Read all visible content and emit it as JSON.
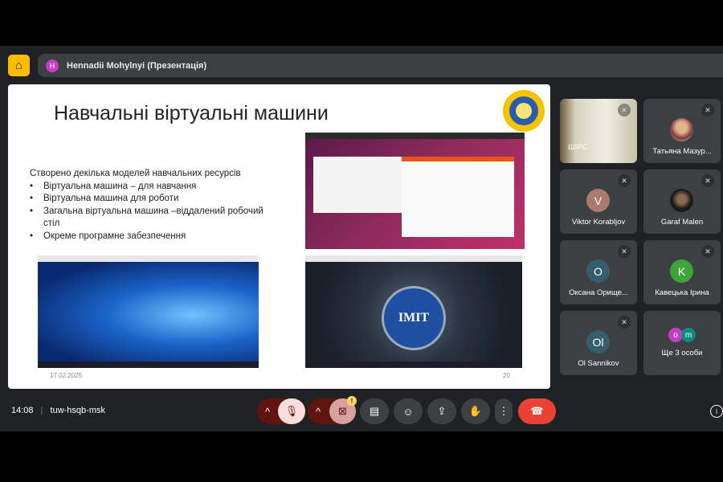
{
  "header": {
    "presenter_initial": "H",
    "presenter_label": "Hennadii Mohylnyi (Презентація)"
  },
  "slide": {
    "title": "Навчальні віртуальні машини",
    "intro": "Створено декілька моделей навчальних ресурсів",
    "bullets": [
      "Віртуальна машина – для навчання",
      "Віртуальна машина для роботи",
      "Загальна віртуальна машина –віддалений робочий стіл",
      "Окреме програмне забезпечення"
    ],
    "date": "17.02.2025",
    "page": "20",
    "imit_label": "IMIT"
  },
  "participants": [
    {
      "name": "ШІРС",
      "type": "video"
    },
    {
      "name": "Татьяна Мазур...",
      "type": "photo"
    },
    {
      "name": "Viktor Korabljov",
      "initial": "V",
      "color": "#a97a6e"
    },
    {
      "name": "Garaf Malen",
      "type": "photo"
    },
    {
      "name": "Оксана Орище...",
      "initial": "О",
      "color": "#355d6b"
    },
    {
      "name": "Кавецька Ірина",
      "initial": "K",
      "color": "#3fa53b"
    },
    {
      "name": "Ol Sannikov",
      "initial": "Ol",
      "color": "#355d6b"
    },
    {
      "name": "Ще 3 особи",
      "initials": [
        "o",
        "m"
      ]
    }
  ],
  "footer": {
    "time": "14:08",
    "meeting_code": "tuw-hsqb-msk",
    "warning": "!"
  },
  "colors": {
    "end_call": "#ea4335",
    "muted_bg": "#f9dedc",
    "danger_dark": "#601410"
  }
}
